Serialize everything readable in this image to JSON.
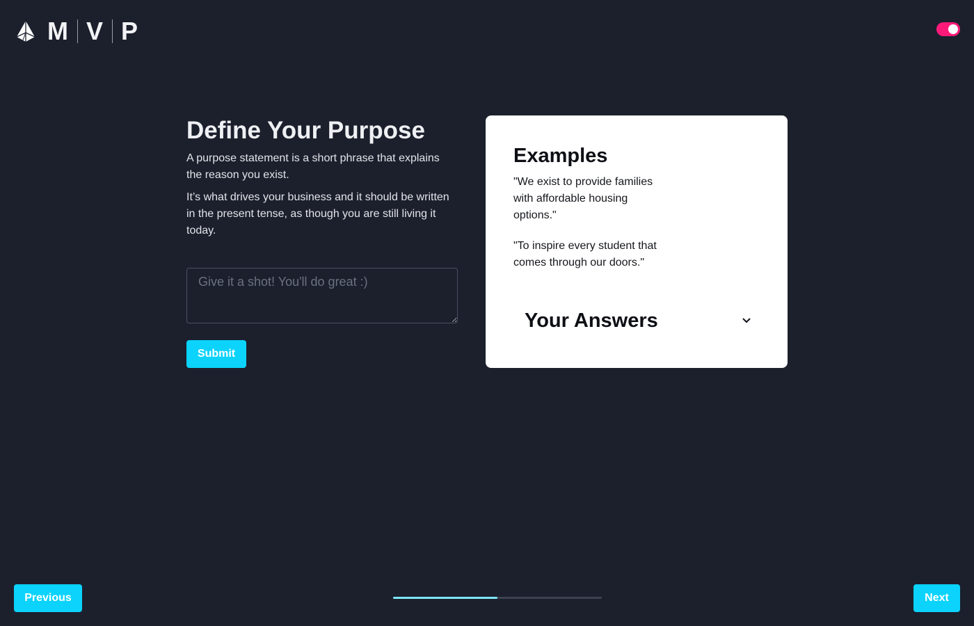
{
  "header": {
    "logo_letters": [
      "M",
      "V",
      "P"
    ],
    "theme_toggle": {
      "state": "on",
      "color": "#ff1a7a"
    }
  },
  "main": {
    "title": "Define Your Purpose",
    "paragraphs": [
      "A purpose statement is a short phrase that explains the reason you exist.",
      "It’s what drives your business and it should be written in the present tense, as though you are still living it today."
    ],
    "input": {
      "placeholder": "Give it a shot! You'll do great :)",
      "value": ""
    },
    "submit_label": "Submit"
  },
  "examples_card": {
    "title": "Examples",
    "examples": [
      "\"We exist to provide families with affordable housing options.\"",
      "\"To inspire every student that comes through our doors.\""
    ],
    "answers_title": "Your Answers",
    "answers_icon": "chevron-down-icon"
  },
  "footer": {
    "previous_label": "Previous",
    "next_label": "Next",
    "progress": 0.5
  },
  "colors": {
    "background": "#1c202d",
    "accent": "#0bd3fb",
    "toggle": "#ff1a7a",
    "progress_fill": "#7fe6fb"
  }
}
